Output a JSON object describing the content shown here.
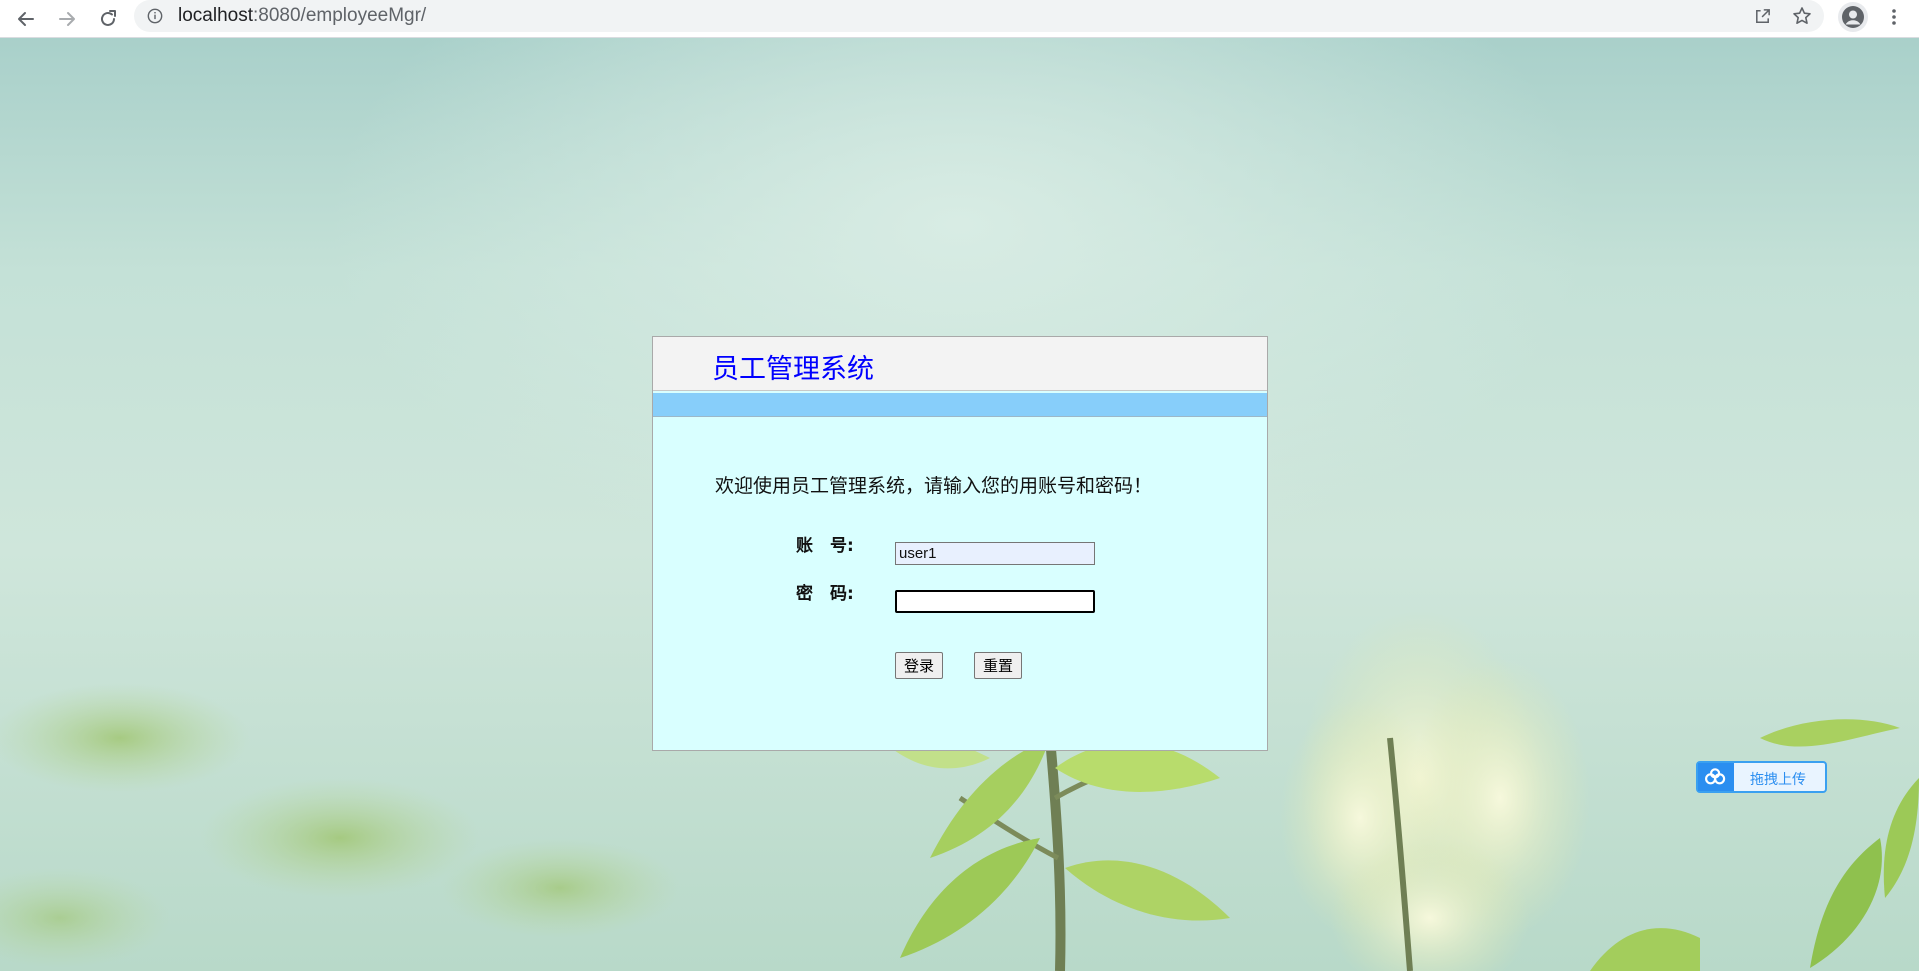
{
  "browser": {
    "url_host": "localhost",
    "url_rest": ":8080/employeeMgr/",
    "icons": {
      "back": "back-arrow-icon",
      "forward": "forward-arrow-icon",
      "reload": "reload-icon",
      "site_info": "info-icon",
      "share": "share-icon",
      "bookmark": "star-icon",
      "profile": "profile-icon",
      "menu": "kebab-menu-icon"
    }
  },
  "login": {
    "system_title": "员工管理系统",
    "welcome_message": "欢迎使用员工管理系统，请输入您的用账号和密码！",
    "username_label": "账　号:",
    "username_value": "user1",
    "password_label": "密　码:",
    "password_value": "",
    "login_button": "登录",
    "reset_button": "重置"
  },
  "upload_widget": {
    "label": "拖拽上传",
    "icon": "cloud-icon"
  },
  "colors": {
    "title_blue": "#0000ff",
    "panel_bg": "#d9ffff",
    "stripe_blue": "#87cefa",
    "upload_accent": "#2b8ef0"
  }
}
